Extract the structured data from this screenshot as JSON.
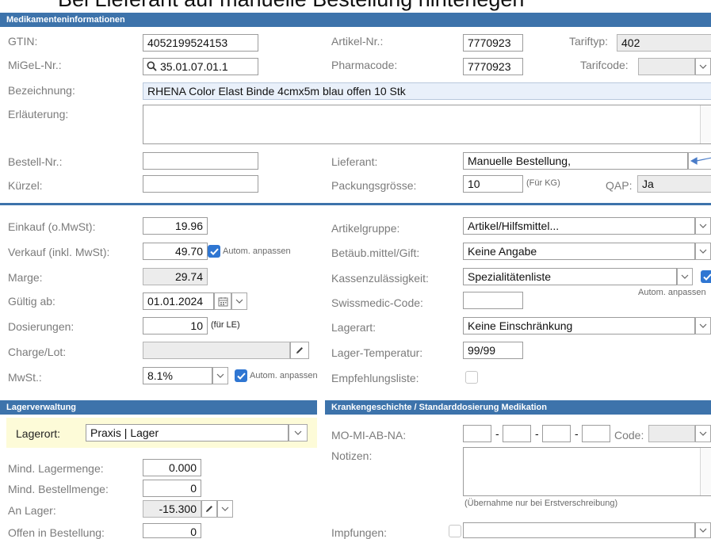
{
  "banner_text": "Bei Lieferant auf manuelle Bestellung hinterlegen",
  "sections": {
    "medikament": "Medikamenteninformationen",
    "lager": "Lagerverwaltung",
    "kg": "Krankengeschichte / Standarddosierung Medikation"
  },
  "fields": {
    "gtin": {
      "label": "GTIN:",
      "value": "4052199524153"
    },
    "artikel_nr": {
      "label": "Artikel-Nr.:",
      "value": "7770923"
    },
    "tariftyp": {
      "label": "Tariftyp:",
      "value": "402"
    },
    "migel_nr": {
      "label": "MiGeL-Nr.:",
      "value": "35.01.07.01.1"
    },
    "pharmacode": {
      "label": "Pharmacode:",
      "value": "7770923"
    },
    "tarifcode": {
      "label": "Tarifcode:",
      "value": ""
    },
    "bezeichnung": {
      "label": "Bezeichnung:",
      "value": "RHENA Color Elast Binde 4cmx5m blau offen 10 Stk"
    },
    "erlaeuterung": {
      "label": "Erläuterung:",
      "value": ""
    },
    "bestell_nr": {
      "label": "Bestell-Nr.:",
      "value": ""
    },
    "lieferant": {
      "label": "Lieferant:",
      "value": "Manuelle Bestellung,"
    },
    "kuerzel": {
      "label": "Kürzel:",
      "value": ""
    },
    "packungsgroesse": {
      "label": "Packungsgrösse:",
      "value": "10",
      "hint": "(Für KG)"
    },
    "qap": {
      "label": "QAP:",
      "value": "Ja"
    },
    "einkauf": {
      "label": "Einkauf (o.MwSt):",
      "value": "19.96"
    },
    "artikelgruppe": {
      "label": "Artikelgruppe:",
      "value": "Artikel/Hilfsmittel..."
    },
    "verkauf": {
      "label": "Verkauf (inkl. MwSt):",
      "value": "49.70",
      "check_label": "Autom. anpassen"
    },
    "betaeub": {
      "label": "Betäub.mittel/Gift:",
      "value": "Keine Angabe"
    },
    "marge": {
      "label": "Marge:",
      "value": "29.74"
    },
    "kassen": {
      "label": "Kassenzulässigkeit:",
      "value": "Spezialitätenliste",
      "check_label": "Autom. anpassen"
    },
    "gueltig_ab": {
      "label": "Gültig ab:",
      "value": "01.01.2024"
    },
    "swissmedic": {
      "label": "Swissmedic-Code:",
      "value": ""
    },
    "dosierungen": {
      "label": "Dosierungen:",
      "value": "10",
      "hint": "(für LE)"
    },
    "lagerart": {
      "label": "Lagerart:",
      "value": "Keine Einschränkung"
    },
    "charge": {
      "label": "Charge/Lot:",
      "value": ""
    },
    "lager_temp": {
      "label": "Lager-Temperatur:",
      "value": "99/99"
    },
    "mwst": {
      "label": "MwSt.:",
      "value": "8.1%",
      "check_label": "Autom. anpassen"
    },
    "empfehlungsliste": {
      "label": "Empfehlungsliste:"
    },
    "lagerort": {
      "label": "Lagerort:",
      "value": "Praxis | Lager"
    },
    "mind_lager": {
      "label": "Mind. Lagermenge:",
      "value": "0.000"
    },
    "mind_bestell": {
      "label": "Mind. Bestellmenge:",
      "value": "0"
    },
    "an_lager": {
      "label": "An Lager:",
      "value": "-15.300"
    },
    "offen": {
      "label": "Offen in Bestellung:",
      "value": "0"
    },
    "momiabna": {
      "label": "MO-MI-AB-NA:",
      "sep": "-"
    },
    "code": {
      "label": "Code:",
      "value": ""
    },
    "notizen": {
      "label": "Notizen:",
      "hint": "(Übernahme nur bei Erstverschreibung)"
    },
    "impfungen": {
      "label": "Impfungen:",
      "value": ""
    }
  },
  "colors": {
    "accent": "#3d73ab",
    "check": "#2f76d2",
    "lager_bg": "#fdfbd8"
  }
}
